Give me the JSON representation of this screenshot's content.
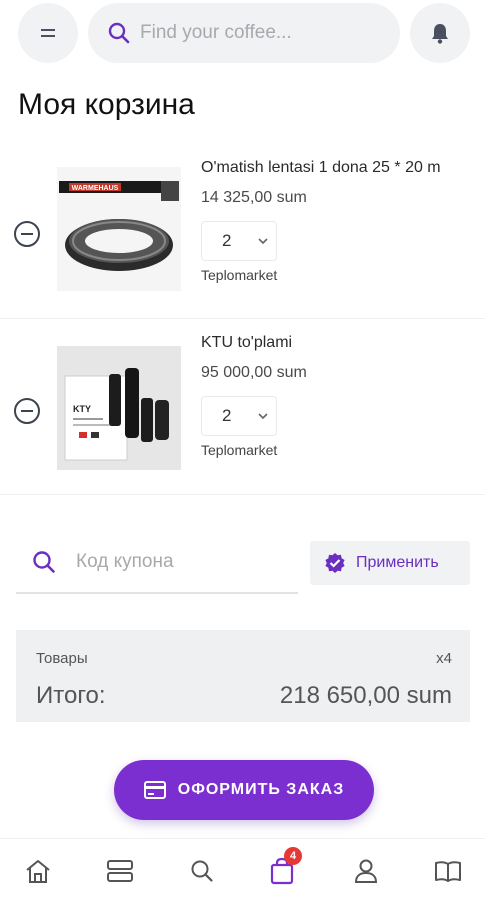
{
  "header": {
    "search_placeholder": "Find your coffee..."
  },
  "page": {
    "title": "Моя корзина"
  },
  "cart": {
    "items": [
      {
        "name": "O'matish lentasi 1 dona 25 * 20 m",
        "price": "14 325,00 sum",
        "quantity": "2",
        "seller": "Teplomarket",
        "image_label": "WARMEHAUS"
      },
      {
        "name": "KTU to'plami",
        "price": "95 000,00 sum",
        "quantity": "2",
        "seller": "Teplomarket",
        "image_label": "KTY"
      }
    ]
  },
  "coupon": {
    "placeholder": "Код купона",
    "apply_label": "Применить"
  },
  "summary": {
    "items_label": "Товары",
    "items_count": "x4",
    "total_label": "Итого:",
    "total_value": "218 650,00 sum"
  },
  "checkout": {
    "label": "ОФОРМИТЬ ЗАКАЗ"
  },
  "nav": {
    "cart_badge": "4",
    "active": "cart"
  },
  "colors": {
    "accent": "#7b2fd0",
    "badge": "#e53935",
    "pill_bg": "#f1f2f4"
  }
}
